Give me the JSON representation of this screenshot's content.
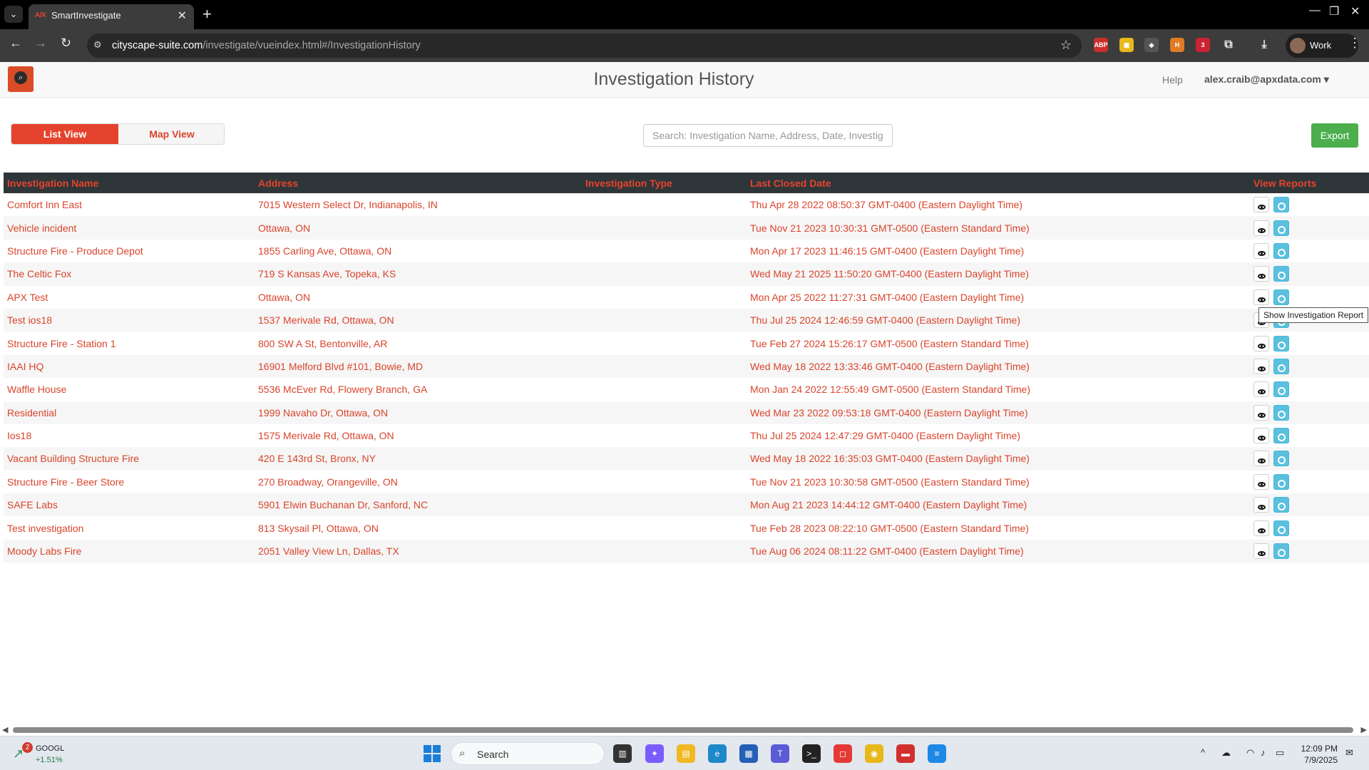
{
  "browser": {
    "tab_title": "SmartInvestigate",
    "tab_favicon_text": "A/X",
    "url_host": "cityscape-suite.com",
    "url_path": "/investigate/vueindex.html#/InvestigationHistory",
    "profile_name": "Work",
    "extension_badge": "3"
  },
  "header": {
    "title": "Investigation History",
    "help_label": "Help",
    "user_email": "alex.craib@apxdata.com",
    "user_caret": "▾"
  },
  "controls": {
    "list_view_label": "List View",
    "map_view_label": "Map View",
    "search_placeholder": "Search: Investigation Name, Address, Date, Investig",
    "export_label": "Export"
  },
  "table": {
    "columns": [
      "Investigation Name",
      "Address",
      "Investigation Type",
      "Last Closed Date",
      "View Reports"
    ],
    "rows": [
      {
        "name": "Comfort Inn East",
        "address": "7015 Western Select Dr, Indianapolis, IN",
        "type": "",
        "date": "Thu Apr 28 2022 08:50:37 GMT-0400 (Eastern Daylight Time)"
      },
      {
        "name": "Vehicle incident",
        "address": "Ottawa, ON",
        "type": "",
        "date": "Tue Nov 21 2023 10:30:31 GMT-0500 (Eastern Standard Time)"
      },
      {
        "name": "Structure Fire - Produce Depot",
        "address": "1855 Carling Ave, Ottawa, ON",
        "type": "",
        "date": "Mon Apr 17 2023 11:46:15 GMT-0400 (Eastern Daylight Time)"
      },
      {
        "name": "The Celtic Fox",
        "address": "719 S Kansas Ave, Topeka, KS",
        "type": "",
        "date": "Wed May 21 2025 11:50:20 GMT-0400 (Eastern Daylight Time)"
      },
      {
        "name": "APX Test",
        "address": "Ottawa, ON",
        "type": "",
        "date": "Mon Apr 25 2022 11:27:31 GMT-0400 (Eastern Daylight Time)"
      },
      {
        "name": "Test ios18",
        "address": "1537 Merivale Rd, Ottawa, ON",
        "type": "",
        "date": "Thu Jul 25 2024 12:46:59 GMT-0400 (Eastern Daylight Time)"
      },
      {
        "name": "Structure Fire - Station 1",
        "address": "800 SW A St, Bentonville, AR",
        "type": "",
        "date": "Tue Feb 27 2024 15:26:17 GMT-0500 (Eastern Standard Time)"
      },
      {
        "name": "IAAI HQ",
        "address": "16901 Melford Blvd #101, Bowie, MD",
        "type": "",
        "date": "Wed May 18 2022 13:33:46 GMT-0400 (Eastern Daylight Time)"
      },
      {
        "name": "Waffle House",
        "address": "5536 McEver Rd, Flowery Branch, GA",
        "type": "",
        "date": "Mon Jan 24 2022 12:55:49 GMT-0500 (Eastern Standard Time)"
      },
      {
        "name": "Residential",
        "address": "1999 Navaho Dr, Ottawa, ON",
        "type": "",
        "date": "Wed Mar 23 2022 09:53:18 GMT-0400 (Eastern Daylight Time)"
      },
      {
        "name": "Ios18",
        "address": "1575 Merivale Rd, Ottawa, ON",
        "type": "",
        "date": "Thu Jul 25 2024 12:47:29 GMT-0400 (Eastern Daylight Time)"
      },
      {
        "name": "Vacant Building Structure Fire",
        "address": "420 E 143rd St, Bronx, NY",
        "type": "",
        "date": "Wed May 18 2022 16:35:03 GMT-0400 (Eastern Daylight Time)"
      },
      {
        "name": "Structure Fire - Beer Store",
        "address": "270 Broadway, Orangeville, ON",
        "type": "",
        "date": "Tue Nov 21 2023 10:30:58 GMT-0500 (Eastern Standard Time)"
      },
      {
        "name": "SAFE Labs",
        "address": "5901 Elwin Buchanan Dr, Sanford, NC",
        "type": "",
        "date": "Mon Aug 21 2023 14:44:12 GMT-0400 (Eastern Daylight Time)"
      },
      {
        "name": "Test investigation",
        "address": "813 Skysail Pl, Ottawa, ON",
        "type": "",
        "date": "Tue Feb 28 2023 08:22:10 GMT-0500 (Eastern Standard Time)"
      },
      {
        "name": "Moody Labs Fire",
        "address": "2051 Valley View Ln, Dallas, TX",
        "type": "",
        "date": "Tue Aug 06 2024 08:11:22 GMT-0400 (Eastern Daylight Time)"
      }
    ]
  },
  "tooltip": {
    "text": "Show Investigation Report"
  },
  "taskbar": {
    "stock_badge": "2",
    "stock_name": "GOOGL",
    "stock_change": "+1.51%",
    "search_label": "Search",
    "time": "12:09 PM",
    "date": "7/9/2025"
  },
  "colors": {
    "accent": "#e5432e",
    "header_bg": "#2f3639",
    "export_green": "#4cae4c",
    "history_btn": "#5bc0de"
  },
  "icons": [
    "search-icon",
    "eye-icon",
    "clock-icon",
    "star-icon",
    "back-icon",
    "forward-icon",
    "reload-icon",
    "download-icon"
  ]
}
